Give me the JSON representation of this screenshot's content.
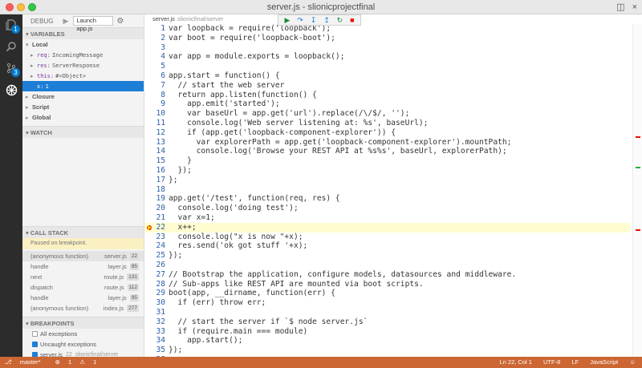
{
  "window": {
    "title": "server.js - slionicprojectfinal"
  },
  "activity": {
    "git_badge": "1",
    "debug_badge": "3"
  },
  "debug": {
    "label": "DEBUG",
    "config_select": "Launch app.js",
    "sections": {
      "variables": "VARIABLES",
      "local": "Local",
      "closure": "Closure",
      "script": "Script",
      "global": "Global",
      "watch": "WATCH",
      "call_stack": "CALL STACK",
      "breakpoints": "BREAKPOINTS"
    },
    "variables": [
      {
        "name": "req:",
        "value": "IncomingMessage"
      },
      {
        "name": "res:",
        "value": "ServerResponse"
      },
      {
        "name": "this:",
        "value": "#<Object>"
      },
      {
        "name": "x:",
        "value": "1"
      }
    ],
    "paused": "Paused on breakpoint.",
    "call_stack": [
      {
        "fn": "(anonymous function)",
        "file": "server.js",
        "line": "22"
      },
      {
        "fn": "handle",
        "file": "layer.js",
        "line": "95"
      },
      {
        "fn": "next",
        "file": "route.js",
        "line": "131"
      },
      {
        "fn": "dispatch",
        "file": "route.js",
        "line": "112"
      },
      {
        "fn": "handle",
        "file": "layer.js",
        "line": "95"
      },
      {
        "fn": "(anonymous function)",
        "file": "index.js",
        "line": "277"
      }
    ],
    "breakpoints": [
      {
        "label": "All exceptions",
        "checked": false,
        "line": "",
        "path": ""
      },
      {
        "label": "Uncaught exceptions",
        "checked": true,
        "line": "",
        "path": ""
      },
      {
        "label": "server.js",
        "checked": true,
        "line": "22",
        "path": "slionicfinal/server"
      }
    ]
  },
  "editor": {
    "tab_file": "server.js",
    "tab_path": "slionicfinal/server",
    "lines": [
      {
        "n": "1",
        "text": "var loopback = require('loopback');"
      },
      {
        "n": "2",
        "text": "var boot = require('loopback-boot');"
      },
      {
        "n": "3",
        "text": ""
      },
      {
        "n": "4",
        "text": "var app = module.exports = loopback();"
      },
      {
        "n": "5",
        "text": ""
      },
      {
        "n": "6",
        "text": "app.start = function() {"
      },
      {
        "n": "7",
        "text": "  // start the web server"
      },
      {
        "n": "8",
        "text": "  return app.listen(function() {"
      },
      {
        "n": "9",
        "text": "    app.emit('started');"
      },
      {
        "n": "10",
        "text": "    var baseUrl = app.get('url').replace(/\\/$/, '');"
      },
      {
        "n": "11",
        "text": "    console.log('Web server listening at: %s', baseUrl);"
      },
      {
        "n": "12",
        "text": "    if (app.get('loopback-component-explorer')) {"
      },
      {
        "n": "13",
        "text": "      var explorerPath = app.get('loopback-component-explorer').mountPath;"
      },
      {
        "n": "14",
        "text": "      console.log('Browse your REST API at %s%s', baseUrl, explorerPath);"
      },
      {
        "n": "15",
        "text": "    }"
      },
      {
        "n": "16",
        "text": "  });"
      },
      {
        "n": "17",
        "text": "};"
      },
      {
        "n": "18",
        "text": ""
      },
      {
        "n": "19",
        "text": "app.get('/test', function(req, res) {"
      },
      {
        "n": "20",
        "text": "  console.log('doing test');"
      },
      {
        "n": "21",
        "text": "  var x=1;"
      },
      {
        "n": "22",
        "text": "  x++;"
      },
      {
        "n": "23",
        "text": "  console.log(\"x is now \"+x);"
      },
      {
        "n": "24",
        "text": "  res.send('ok got stuff '+x);"
      },
      {
        "n": "25",
        "text": "});"
      },
      {
        "n": "26",
        "text": ""
      },
      {
        "n": "27",
        "text": "// Bootstrap the application, configure models, datasources and middleware."
      },
      {
        "n": "28",
        "text": "// Sub-apps like REST API are mounted via boot scripts."
      },
      {
        "n": "29",
        "text": "boot(app, __dirname, function(err) {"
      },
      {
        "n": "30",
        "text": "  if (err) throw err;"
      },
      {
        "n": "31",
        "text": ""
      },
      {
        "n": "32",
        "text": "  // start the server if `$ node server.js`"
      },
      {
        "n": "33",
        "text": "  if (require.main === module)"
      },
      {
        "n": "34",
        "text": "    app.start();"
      },
      {
        "n": "35",
        "text": "});"
      },
      {
        "n": "36",
        "text": ""
      }
    ]
  },
  "status": {
    "branch": "master*",
    "errors": "1",
    "warnings": "1",
    "position": "Ln 22, Col 1",
    "encoding": "UTF-8",
    "eol": "LF",
    "language": "JavaScript"
  },
  "colors": {
    "statusbar": "#cc6633",
    "accent": "#1c7ed6",
    "breakpoint": "#e51400"
  }
}
